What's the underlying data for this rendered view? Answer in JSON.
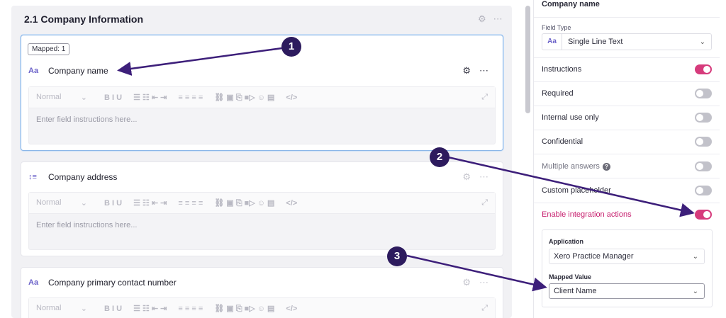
{
  "section": {
    "title": "2.1  Company Information"
  },
  "fields": [
    {
      "mapped_badge": "Mapped: 1",
      "type_icon": "Aa",
      "name": "Company name",
      "placeholder": "Enter field instructions here..."
    },
    {
      "type_icon": "↕≡",
      "name": "Company address",
      "placeholder": "Enter field instructions here..."
    },
    {
      "type_icon": "Aa",
      "name": "Company primary contact number"
    }
  ],
  "toolbar": {
    "style_select": "Normal",
    "format_icons": "B I U",
    "list_icons": "☰ ☷ ⇤ ⇥",
    "align_icons": "≡ ≡ ≡ ≡",
    "insert_icons": "⛓ ▣ ⎘ ■▷ ☺ ▤",
    "code_icon": "</>",
    "expand_icon": "⤢"
  },
  "right_panel": {
    "title": "Company name",
    "field_type_label": "Field Type",
    "field_type_icon": "Aa",
    "field_type_value": "Single Line Text",
    "options": [
      {
        "label": "Instructions",
        "on": true
      },
      {
        "label": "Required",
        "on": false
      },
      {
        "label": "Internal use only",
        "on": false
      },
      {
        "label": "Confidential",
        "on": false
      },
      {
        "label": "Multiple answers",
        "on": false,
        "help": "?"
      },
      {
        "label": "Custom placeholder",
        "on": false
      },
      {
        "label": "Enable integration actions",
        "on": true
      }
    ],
    "integration": {
      "application_label": "Application",
      "application_value": "Xero Practice Manager",
      "mapped_value_label": "Mapped Value",
      "mapped_value": "Client Name"
    }
  },
  "annotations": [
    "1",
    "2",
    "3"
  ],
  "colors": {
    "toggle_on": "#d63b7c",
    "annotation": "#2d1b5e",
    "accent": "#6b62c9"
  }
}
